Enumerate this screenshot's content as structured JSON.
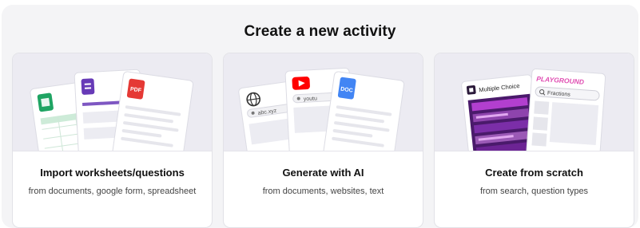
{
  "heading": "Create a new activity",
  "cards": [
    {
      "title": "Import worksheets/questions",
      "subtitle": "from documents, google form, spreadsheet",
      "art": {
        "pdf_label": "PDF"
      }
    },
    {
      "title": "Generate with AI",
      "subtitle": "from documents, websites, text",
      "art": {
        "url_text": "abc.xyz",
        "video_text": "youtu",
        "doc_label": "DOC"
      }
    },
    {
      "title": "Create from scratch",
      "subtitle": "from search, question types",
      "art": {
        "mc_label": "Multiple Choice",
        "brand": "PLAYGROUND",
        "search_text": "Fractions"
      }
    }
  ],
  "colors": {
    "sheets_green": "#1fa463",
    "forms_purple": "#673ab7",
    "pdf_red": "#e53935",
    "youtube_red": "#ff0000",
    "docs_blue": "#4285f4",
    "playground_pink": "#e04fb3"
  }
}
